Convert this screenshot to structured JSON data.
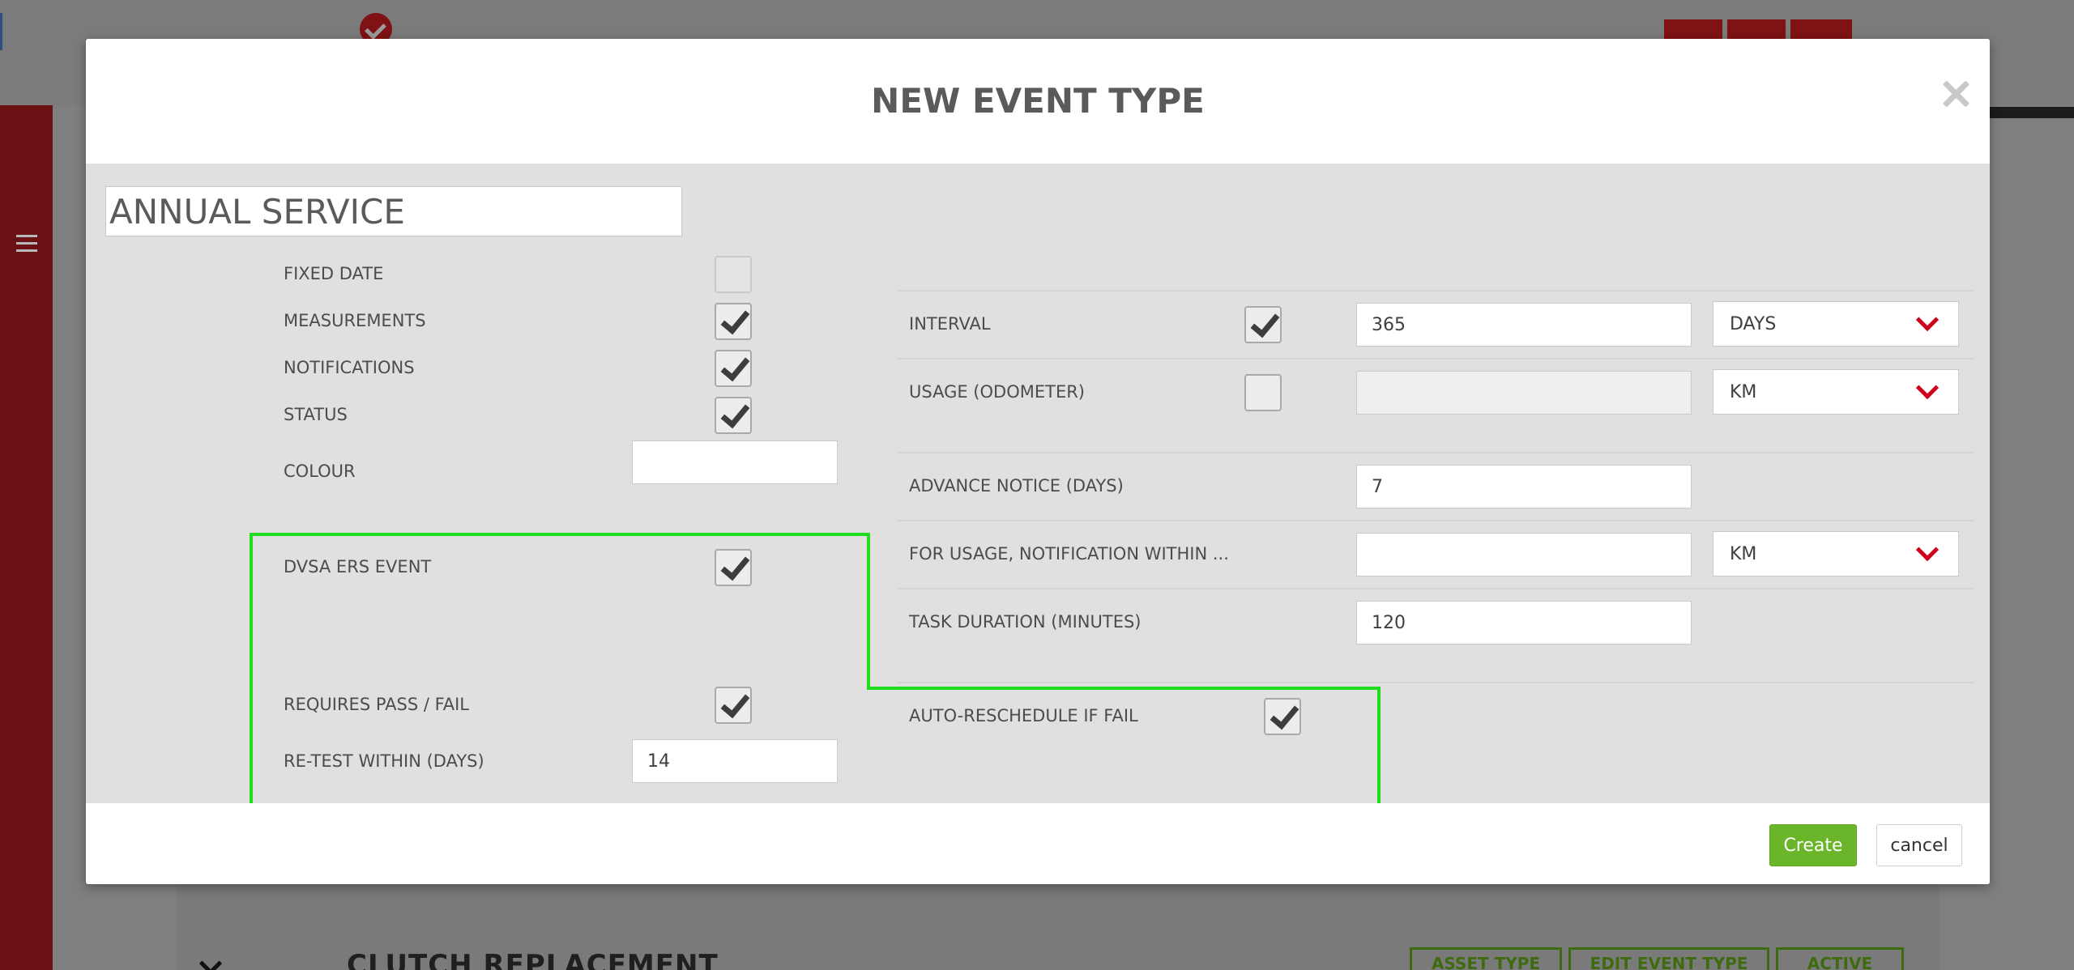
{
  "background": {
    "section_heading": "CLUTCH REPLACEMENT",
    "buttons": [
      "ASSET TYPE",
      "EDIT EVENT TYPE",
      "ACTIVE"
    ]
  },
  "modal": {
    "title": "NEW EVENT TYPE",
    "name_value": "ANNUAL SERVICE",
    "left": {
      "fixed_date": {
        "label": "FIXED DATE",
        "checked": false
      },
      "measurements": {
        "label": "MEASUREMENTS",
        "checked": true
      },
      "notifications": {
        "label": "NOTIFICATIONS",
        "checked": true
      },
      "status": {
        "label": "STATUS",
        "checked": true
      },
      "colour": {
        "label": "COLOUR",
        "value": ""
      },
      "dvsa_ers_event": {
        "label": "DVSA ERS EVENT",
        "checked": true
      },
      "requires_pass_fail": {
        "label": "REQUIRES PASS / FAIL",
        "checked": true
      },
      "retest_within": {
        "label": "RE-TEST WITHIN (DAYS)",
        "value": "14"
      }
    },
    "right": {
      "interval": {
        "label": "INTERVAL",
        "checked": true,
        "value": "365",
        "unit": "DAYS"
      },
      "usage": {
        "label": "USAGE (ODOMETER)",
        "checked": false,
        "value": "",
        "unit": "KM"
      },
      "advance_notice": {
        "label": "ADVANCE NOTICE (DAYS)",
        "value": "7"
      },
      "usage_notification": {
        "label": "FOR USAGE, NOTIFICATION WITHIN ...",
        "value": "",
        "unit": "KM"
      },
      "task_duration": {
        "label": "TASK DURATION (MINUTES)",
        "value": "120"
      },
      "auto_reschedule": {
        "label": "AUTO-RESCHEDULE IF FAIL",
        "checked": true
      }
    },
    "footer": {
      "create_label": "Create",
      "cancel_label": "cancel"
    }
  },
  "colors": {
    "accent_green": "#6ab52a",
    "highlight_green": "#1fdc1f",
    "chevron_red": "#d0021b",
    "sidebar_red": "#6c1114"
  }
}
